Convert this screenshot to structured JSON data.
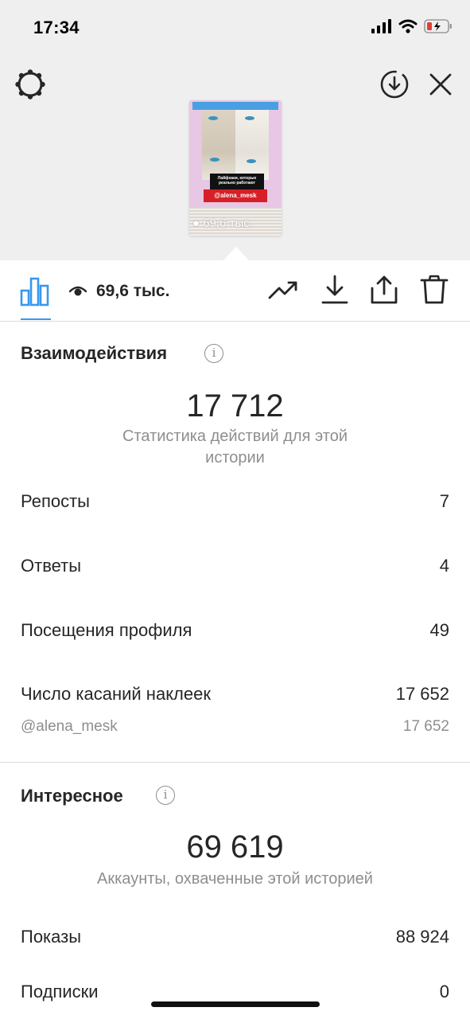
{
  "status_bar": {
    "time": "17:34",
    "icons": [
      "signal-icon",
      "wifi-icon",
      "battery-low-icon"
    ],
    "battery_color": "#e0403b"
  },
  "header_icons": {
    "settings": "gear-icon",
    "download": "download-circle-icon",
    "close": "close-icon"
  },
  "story_preview": {
    "caption": "Лайфхаки, которые реально работают",
    "tag": "@alena_mesk",
    "views": "69,6 тыс."
  },
  "toolbar": {
    "views": "69,6 тыс.",
    "accent": "#3897f0",
    "icons": [
      "insights-icon",
      "eye-icon",
      "trend-icon",
      "download-icon",
      "share-icon",
      "trash-icon"
    ]
  },
  "interactions": {
    "title": "Взаимодействия",
    "total": "17 712",
    "caption": "Статистика действий для этой истории",
    "rows": [
      {
        "label": "Репосты",
        "value": "7"
      },
      {
        "label": "Ответы",
        "value": "4"
      },
      {
        "label": "Посещения профиля",
        "value": "49"
      },
      {
        "label": "Число касаний наклеек",
        "value": "17 652"
      }
    ],
    "sub_row": {
      "label": "@alena_mesk",
      "value": "17 652"
    }
  },
  "discovery": {
    "title": "Интересное",
    "total": "69 619",
    "caption": "Аккаунты, охваченные этой историей",
    "rows": [
      {
        "label": "Показы",
        "value": "88 924"
      },
      {
        "label": "Подписки",
        "value": "0"
      }
    ]
  }
}
